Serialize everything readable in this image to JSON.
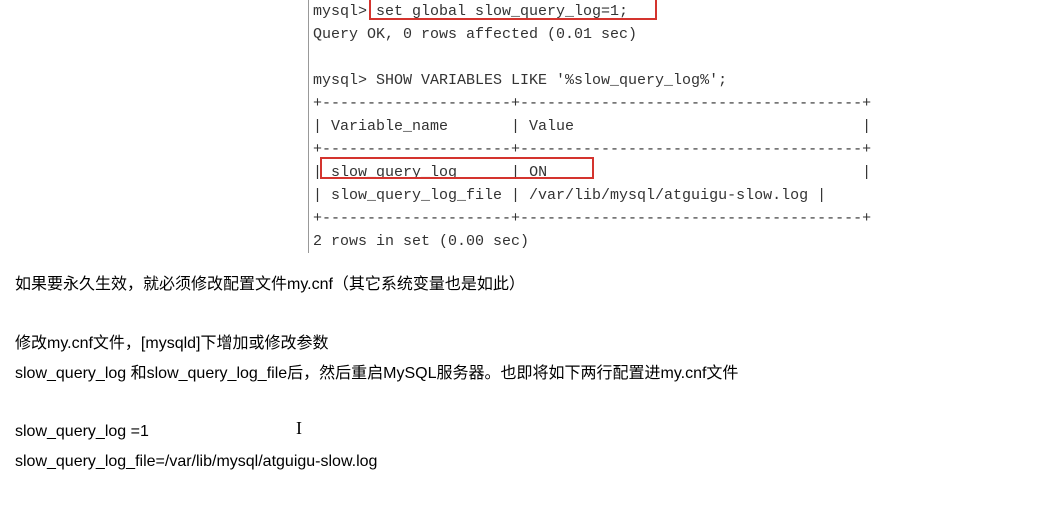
{
  "code": {
    "line1_prompt": "mysql>",
    "line1_cmd": " set global slow_query_log=1;",
    "line2": "Query OK, 0 rows affected (0.01 sec)",
    "line3": "",
    "line4": "mysql> SHOW VARIABLES LIKE '%slow_query_log%';",
    "line5": "+---------------------+--------------------------------------+",
    "line6": "| Variable_name       | Value                                |",
    "line7": "+---------------------+--------------------------------------+",
    "line8_a": "|",
    "line8_b": " slow_query_log      ",
    "line8_c": "|",
    "line8_d": " ON  ",
    "line8_e": "                                 |",
    "line9": "| slow_query_log_file | /var/lib/mysql/atguigu-slow.log |",
    "line10": "+---------------------+--------------------------------------+",
    "line11": "2 rows in set (0.00 sec)"
  },
  "para": {
    "p1": "如果要永久生效，就必须修改配置文件my.cnf（其它系统变量也是如此）",
    "p2": "修改my.cnf文件，[mysqld]下增加或修改参数",
    "p3": "slow_query_log 和slow_query_log_file后，然后重启MySQL服务器。也即将如下两行配置进my.cnf文件",
    "p4": "slow_query_log =1",
    "p5": "slow_query_log_file=/var/lib/mysql/atguigu-slow.log"
  },
  "cursor": "I"
}
